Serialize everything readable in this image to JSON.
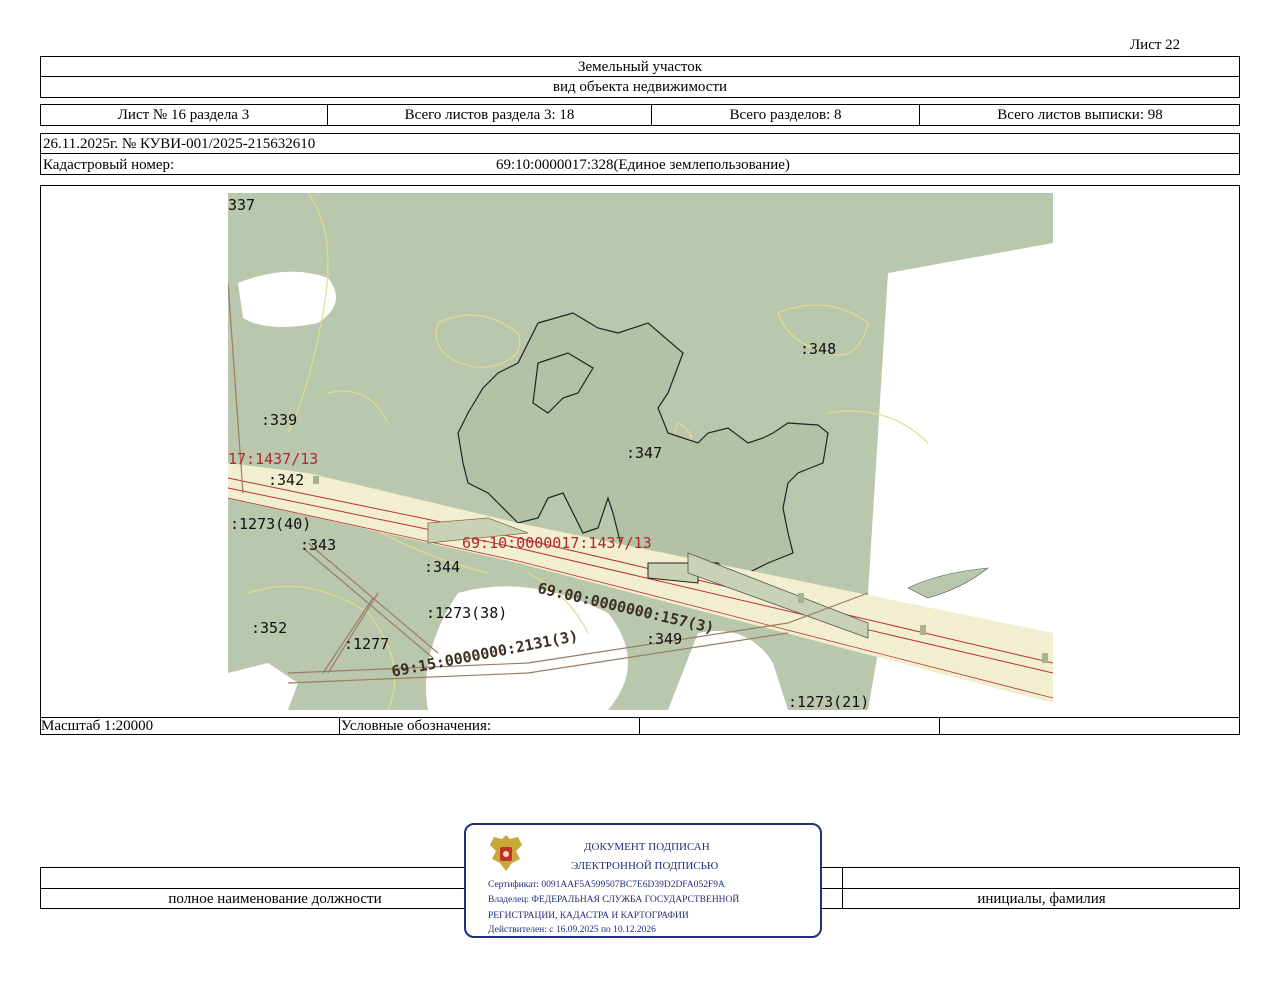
{
  "sheet_label": "Лист 22",
  "header": {
    "title": "Земельный участок",
    "subtitle": "вид объекта недвижимости"
  },
  "sheet_info": {
    "sheet_num": "Лист № 16 раздела 3",
    "total_in_section": "Всего листов раздела 3: 18",
    "total_sections": "Всего разделов: 8",
    "total_sheets": "Всего листов выписки: 98"
  },
  "doc_line": "26.11.2025г. № КУВИ-001/2025-215632610",
  "cadastral": {
    "label": "Кадастровый номер:",
    "value": "69:10:0000017:328(Единое землепользование)"
  },
  "map": {
    "labels": {
      "l337": "337",
      "l339": ":339",
      "l348": ":348",
      "l347": ":347",
      "l1437_left": "17:1437/13",
      "l342": ":342",
      "l1273_40": ":1273(40)",
      "l343": ":343",
      "l1437_main": "69:10:0000017:1437/13",
      "l344": ":344",
      "l157": "69:00:0000000:157(3)",
      "l1273_38": ":1273(38)",
      "l352": ":352",
      "l1277": ":1277",
      "l2131": "69:15:0000000:2131(3)",
      "l349": ":349",
      "l1273_21": ":1273(21)"
    },
    "colors": {
      "forest": "#b9c7ad",
      "road": "#f1efcf",
      "boundary_red": "#c0302c",
      "boundary_yellow": "#e7e2a0"
    }
  },
  "footer_row": {
    "scale": "Масштаб 1:20000",
    "legend": "Условные обозначения:"
  },
  "signature": {
    "position_label": "полное наименование должности",
    "name_label": "инициалы, фамилия"
  },
  "stamp": {
    "icon": "coat-of-arms-icon",
    "line1": "ДОКУМЕНТ ПОДПИСАН",
    "line2": "ЭЛЕКТРОННОЙ ПОДПИСЬЮ",
    "cert": "Сертификат: 0091AAF5A599507BC7E6D39D2DFA052F9A",
    "owner1": "Владелец: ФЕДЕРАЛЬНАЯ СЛУЖБА ГОСУДАРСТВЕННОЙ",
    "owner2": "РЕГИСТРАЦИИ, КАДАСТРА И КАРТОГРАФИИ",
    "valid": "Действителен: с 16.09.2025 по 10.12.2026",
    "color": "#1f2f7a"
  }
}
